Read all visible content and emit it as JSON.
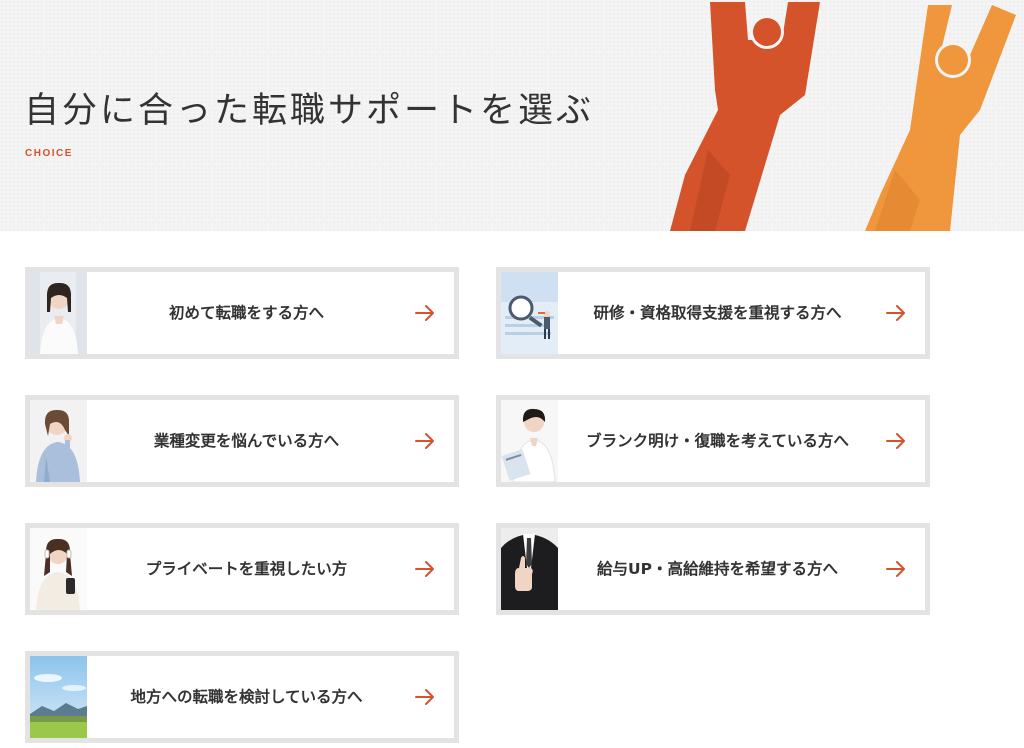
{
  "hero": {
    "title": "自分に合った転職サポートを選ぶ",
    "subtitle": "CHOICE"
  },
  "colors": {
    "accent": "#d4532a",
    "accent_light": "#f0963c",
    "card_border": "#e3e3e3"
  },
  "cards": [
    {
      "label": "初めて転職をする方へ",
      "icon": "arrow-right-icon"
    },
    {
      "label": "研修・資格取得支援を重視する方へ",
      "icon": "arrow-right-icon"
    },
    {
      "label": "業種変更を悩んでいる方へ",
      "icon": "arrow-right-icon"
    },
    {
      "label": "ブランク明け・復職を考えている方へ",
      "icon": "arrow-right-icon"
    },
    {
      "label": "プライベートを重視したい方",
      "icon": "arrow-right-icon"
    },
    {
      "label": "給与UP・高給維持を希望する方へ",
      "icon": "arrow-right-icon"
    },
    {
      "label": "地方への転職を検討している方へ",
      "icon": "arrow-right-icon"
    }
  ]
}
